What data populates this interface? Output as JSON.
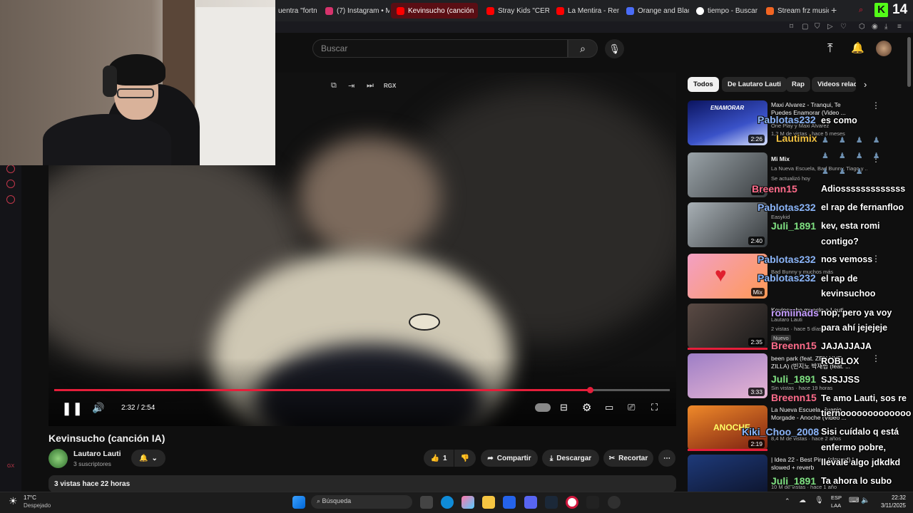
{
  "browser": {
    "tabs": [
      {
        "title": "uentra \"fortnit",
        "color": "#cccccc"
      },
      {
        "title": "(7) Instagram • M",
        "color": "#d6336c"
      },
      {
        "title": "Kevinsucho (canción",
        "color": "#ff0000",
        "active": true
      },
      {
        "title": "Stray Kids \"CERE",
        "color": "#ff0000"
      },
      {
        "title": "La Mentira - Rem",
        "color": "#ff0000"
      },
      {
        "title": "Orange and Black",
        "color": "#4a6cf7"
      },
      {
        "title": "tiempo - Buscar c",
        "color": "#ffffff"
      },
      {
        "title": "Stream frz music",
        "color": "#f26522"
      }
    ],
    "new_tab": "+",
    "kick_logo": "K",
    "kick_count": "14"
  },
  "youtube": {
    "search_placeholder": "Buscar",
    "player": {
      "time": "2:32 / 2:54",
      "progress": 0.87,
      "top_label": "RGX"
    },
    "video": {
      "title": "Kevinsucho (canción IA)",
      "channel": "Lautaro Lauti",
      "subscribers": "3 suscriptores",
      "likes": "1",
      "share": "Compartir",
      "download": "Descargar",
      "clip": "Recortar",
      "description": "3 vistas  hace 22 horas"
    },
    "chips": [
      "Todos",
      "De Lautaro Lauti",
      "Rap",
      "Videos relac"
    ],
    "related": [
      {
        "t1": "Maxi Alvarez - Tranqui, Te",
        "t2": "Puedes Enamorar (Video ...",
        "m1": "One Play y Maxi Alvarez",
        "m2": "1,2 M de vistas · hace 5 meses",
        "dur": "2:26"
      },
      {
        "t1": "Mi Mix",
        "t2": "",
        "m1": "La Nueva Escuela, Bad Bunny, Tiago y ...",
        "m2": "Se actualizó hoy",
        "dur": "Mix"
      },
      {
        "t1": "",
        "t2": "",
        "m1": "Easykid",
        "m2": "",
        "dur": "2:40"
      },
      {
        "t1": "",
        "t2": "",
        "m1": "Bad Bunny y muchos más",
        "m2": "",
        "dur": "Mix"
      },
      {
        "t1": "Kevinsucho mueslo a Lauti",
        "t2": "",
        "m1": "Lautaro Lauti",
        "m2": "2 vistas · hace 5 días",
        "badge": "Nuevo",
        "dur": "2:35"
      },
      {
        "t1": "been park (feat. ZEN HUE",
        "t2": "ZILLA) (빈지노 박재범 (feat. ...",
        "m1": "",
        "m2": "Sin vistas · hace 19 horas",
        "dur": "3:33"
      },
      {
        "t1": "La Nueva Escuela, Juanio",
        "t2": "Morgade - Anoche (Video ...",
        "m1": "",
        "m2": "8,4 M de vistas · hace 2 años",
        "dur": "2:19"
      },
      {
        "t1": "| Idea 22 - Best Pinu (slowed) |",
        "t2": "slowed + reverb",
        "m1": "",
        "m2": "10 M de vistas · hace 1 año",
        "dur": ""
      }
    ]
  },
  "chat": [
    {
      "user": "Pablotas232",
      "msg": "es como",
      "color": "#8ab4f8"
    },
    {
      "user": "Lautimix",
      "msg": "",
      "color": "#f0c040"
    },
    {
      "user": "Breenn15",
      "msg": "Adiosssssssssssss",
      "color": "#ff6b8a"
    },
    {
      "user": "Pablotas232",
      "msg": "el rap de fernanfloo",
      "color": "#8ab4f8"
    },
    {
      "user": "Juli_1891",
      "msg": "kev, esta romi",
      "msg2": "contigo?",
      "color": "#7ee081"
    },
    {
      "user": "Pablotas232",
      "msg": "nos vemoss",
      "color": "#8ab4f8"
    },
    {
      "user": "Pablotas232",
      "msg": "el rap de",
      "msg2": "kevinsuchoo",
      "color": "#8ab4f8"
    },
    {
      "user": "romiinads",
      "msg": "nop, pero ya voy",
      "msg2": "para ahí jejejeje",
      "color": "#c49cff"
    },
    {
      "user": "Breenn15",
      "msg": "JAJAJJAJA",
      "msg2": "ROBLOX",
      "color": "#ff6b8a"
    },
    {
      "user": "Juli_1891",
      "msg": "SJSJJSS",
      "color": "#7ee081"
    },
    {
      "user": "Breenn15",
      "msg": "Te amo Lauti, sos re",
      "msg2": "tiernooooooooooooo",
      "color": "#ff6b8a"
    },
    {
      "user": "Kiki_Choo_2008",
      "msg": "Sisi cuídalo q está",
      "msg2": "enfermo pobre,",
      "msg3": "llevale algo jdkdkd",
      "color": "#8ab4f8"
    },
    {
      "user": "Juli_1891",
      "msg": "Ta ahora lo subo",
      "color": "#7ee081"
    }
  ],
  "taskbar": {
    "temp": "17°C",
    "weather": "Despejado",
    "search": "Búsqueda",
    "lang1": "ESP",
    "lang2": "LAA",
    "time": "22:32",
    "date": "3/11/2025"
  }
}
